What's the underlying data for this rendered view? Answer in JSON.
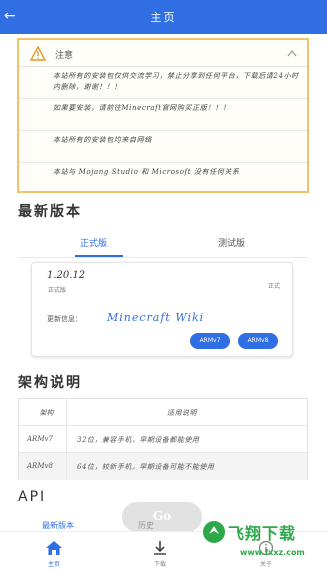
{
  "header": {
    "back_icon": "back-arrow-icon",
    "title": "主页"
  },
  "notice": {
    "title": "注意",
    "items": [
      "本站所有的安装包仅供交流学习，禁止分享到任何平台，下载后请24小时内删除，谢谢！！！",
      "如果要安装，请前往Minecraft官网购买正版！！！",
      "本站所有的安装包均来自网络",
      "本站与 Mojang Studio 和 Microsoft 没有任何关系"
    ]
  },
  "latest": {
    "title": "最新版本",
    "tabs": [
      "正式版",
      "测试版"
    ],
    "card": {
      "version": "1.20.12",
      "type": "正式版",
      "type_right": "正式",
      "info_label": "更新信息：",
      "wiki": "Minecraft Wiki",
      "buttons": [
        "ARMv7",
        "ARMv8"
      ]
    }
  },
  "arch": {
    "title": "架构说明",
    "header": [
      "架构",
      "适用说明"
    ],
    "rows": [
      [
        "ARMv7",
        "32位，兼容手机，早期设备都能使用"
      ],
      [
        "ARMv8",
        "64位，较新手机，早期设备可能不能使用"
      ]
    ]
  },
  "api": {
    "title": "API"
  },
  "bottom_tabs": [
    "最新版本",
    "历史"
  ],
  "fab_label": "Go",
  "nav": [
    {
      "label": "主页",
      "icon": "home-icon"
    },
    {
      "label": "下载",
      "icon": "download-icon"
    },
    {
      "label": "关于",
      "icon": "info-icon"
    }
  ],
  "watermark": {
    "word": "飞翔下载",
    "url": "www.fxxz.com"
  },
  "colors": {
    "primary": "#2f6fe3",
    "warning": "#f0c26a"
  }
}
